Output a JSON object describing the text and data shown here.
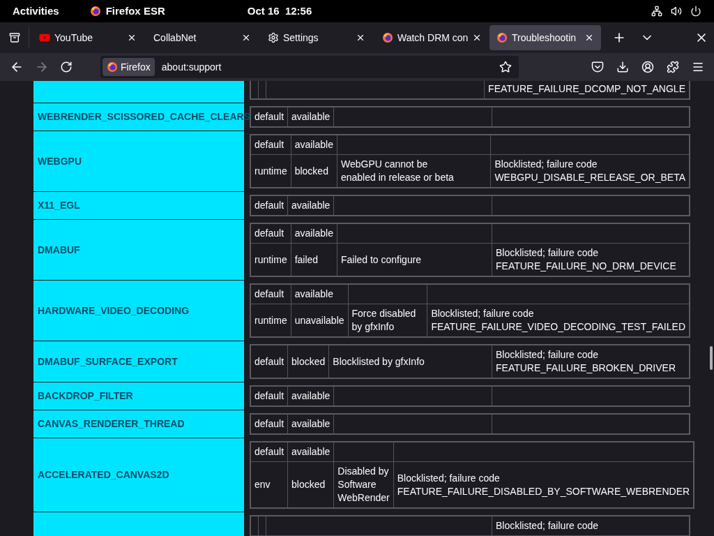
{
  "top_bar": {
    "activities": "Activities",
    "app": "Firefox ESR",
    "clock": "Oct 16  12:56"
  },
  "tabs": [
    {
      "title": "YouTube",
      "kind": "youtube",
      "selected": false
    },
    {
      "title": "CollabNet",
      "kind": "plain",
      "selected": false
    },
    {
      "title": "Settings",
      "kind": "settings",
      "selected": false
    },
    {
      "title": "Watch DRM con",
      "kind": "firefox",
      "selected": false
    },
    {
      "title": "Troubleshootin",
      "kind": "firefox",
      "selected": true
    }
  ],
  "toolbar": {
    "forward_disabled": true,
    "identity": "Firefox",
    "url": "about:support"
  },
  "features": [
    {
      "entries": [
        {
          "failure": "FEATURE_FAILURE_DCOMP_NOT_ANGLE"
        }
      ]
    },
    {
      "name": "WEBRENDER_SCISSORED_CACHE_CLEARS",
      "entries": [
        {
          "type": "default",
          "status": "available"
        }
      ]
    },
    {
      "name": "WEBGPU",
      "entries": [
        {
          "type": "default",
          "status": "available"
        },
        {
          "type": "runtime",
          "status": "blocked",
          "message": "WebGPU cannot be\nenabled in release or beta",
          "failure": "Blocklisted; failure code\nWEBGPU_DISABLE_RELEASE_OR_BETA"
        }
      ]
    },
    {
      "name": "X11_EGL",
      "entries": [
        {
          "type": "default",
          "status": "available"
        }
      ]
    },
    {
      "name": "DMABUF",
      "entries": [
        {
          "type": "default",
          "status": "available"
        },
        {
          "type": "runtime",
          "status": "failed",
          "message": "Failed to configure",
          "failure": "Blocklisted; failure code\nFEATURE_FAILURE_NO_DRM_DEVICE"
        }
      ]
    },
    {
      "name": "HARDWARE_VIDEO_DECODING",
      "entries": [
        {
          "type": "default",
          "status": "available"
        },
        {
          "type": "runtime",
          "status": "unavailable",
          "message": "Force disabled\nby gfxInfo",
          "failure": "Blocklisted; failure code\nFEATURE_FAILURE_VIDEO_DECODING_TEST_FAILED"
        }
      ]
    },
    {
      "name": "DMABUF_SURFACE_EXPORT",
      "entries": [
        {
          "type": "default",
          "status": "blocked",
          "message": "Blocklisted by gfxInfo",
          "failure": "Blocklisted; failure code\nFEATURE_FAILURE_BROKEN_DRIVER"
        }
      ]
    },
    {
      "name": "BACKDROP_FILTER",
      "entries": [
        {
          "type": "default",
          "status": "available"
        }
      ]
    },
    {
      "name": "CANVAS_RENDERER_THREAD",
      "entries": [
        {
          "type": "default",
          "status": "available"
        }
      ]
    },
    {
      "name": "ACCELERATED_CANVAS2D",
      "entries": [
        {
          "type": "default",
          "status": "available"
        },
        {
          "type": "env",
          "status": "blocked",
          "message": "Disabled by\nSoftware\nWebRender",
          "failure": "Blocklisted; failure code\nFEATURE_FAILURE_DISABLED_BY_SOFTWARE_WEBRENDER"
        }
      ]
    },
    {
      "entries": [
        {
          "failure": "Blocklisted; failure code"
        }
      ]
    }
  ]
}
